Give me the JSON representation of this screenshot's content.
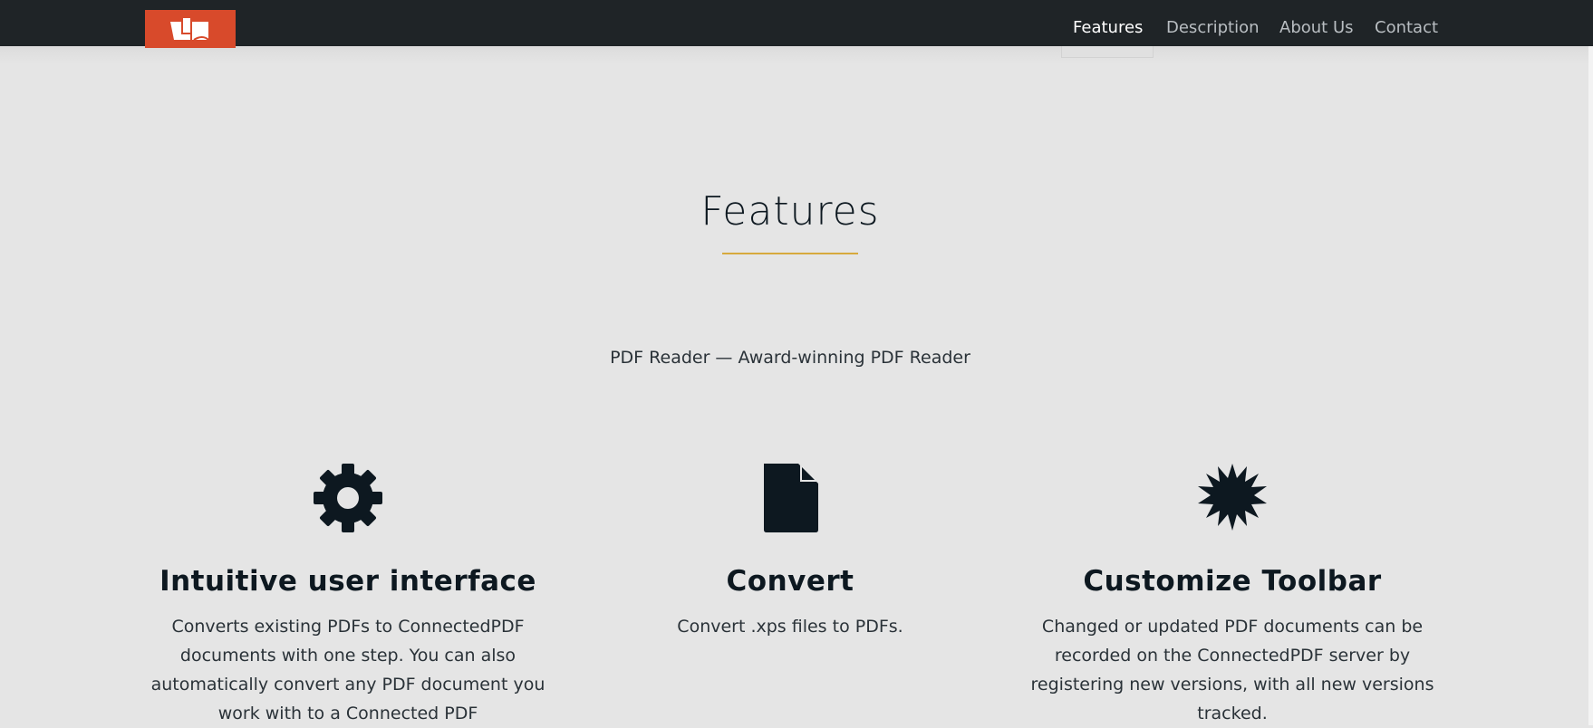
{
  "nav": {
    "links": [
      "Features",
      "Description",
      "About Us",
      "Contact"
    ],
    "active": "Features"
  },
  "brand": {
    "logo_color": "#d84a2b"
  },
  "section": {
    "title": "Features",
    "subtitle": "PDF Reader — Award-winning PDF Reader",
    "accent_color": "#d7a93d"
  },
  "features": [
    {
      "icon": "gear-icon",
      "title": "Intuitive user interface",
      "text": "Converts existing PDFs to ConnectedPDF documents with one step. You can also automatically convert any PDF document you work with to a Connected PDF"
    },
    {
      "icon": "file-icon",
      "title": "Convert",
      "text": "Convert .xps files to PDFs."
    },
    {
      "icon": "certificate-icon",
      "title": "Customize Toolbar",
      "text": "Changed or updated PDF documents can be recorded on the ConnectedPDF server by registering new versions, with all new versions tracked."
    }
  ]
}
